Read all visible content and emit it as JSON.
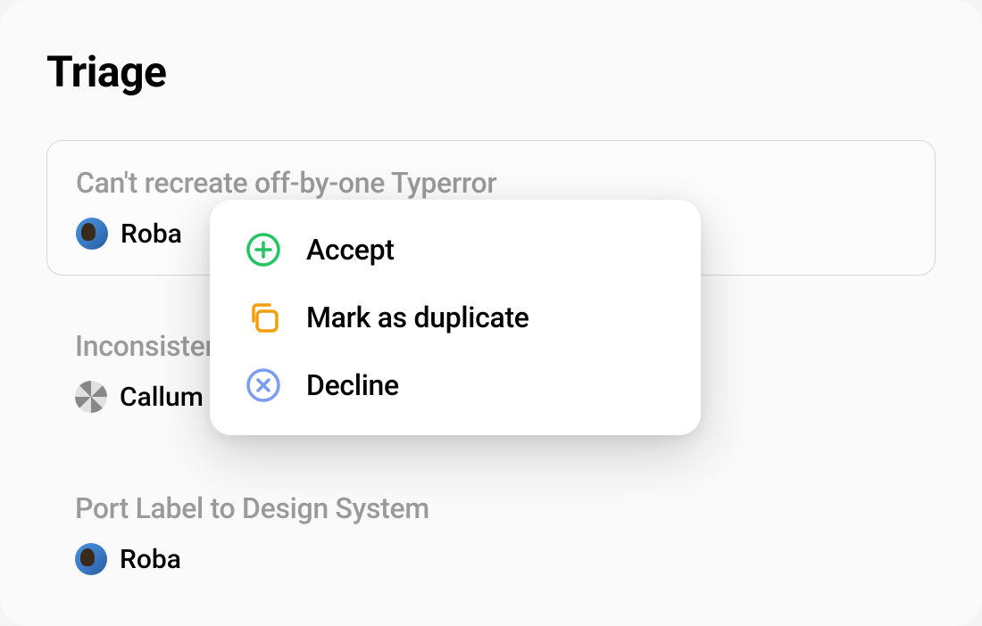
{
  "title": "Triage",
  "issues": [
    {
      "title": "Can't recreate off-by-one Typerror",
      "assignee": "Roba",
      "avatar_type": "roba",
      "selected": true
    },
    {
      "title": "Inconsister",
      "assignee": "Callum",
      "avatar_type": "callum",
      "selected": false
    },
    {
      "title": "Port Label to Design System",
      "assignee": "Roba",
      "avatar_type": "roba",
      "selected": false
    }
  ],
  "context_menu": {
    "items": [
      {
        "label": "Accept",
        "icon": "plus-circle",
        "color": "#22c55e"
      },
      {
        "label": "Mark as duplicate",
        "icon": "copy",
        "color": "#f59e0b"
      },
      {
        "label": "Decline",
        "icon": "x-circle",
        "color": "#6b8ff5"
      }
    ]
  }
}
